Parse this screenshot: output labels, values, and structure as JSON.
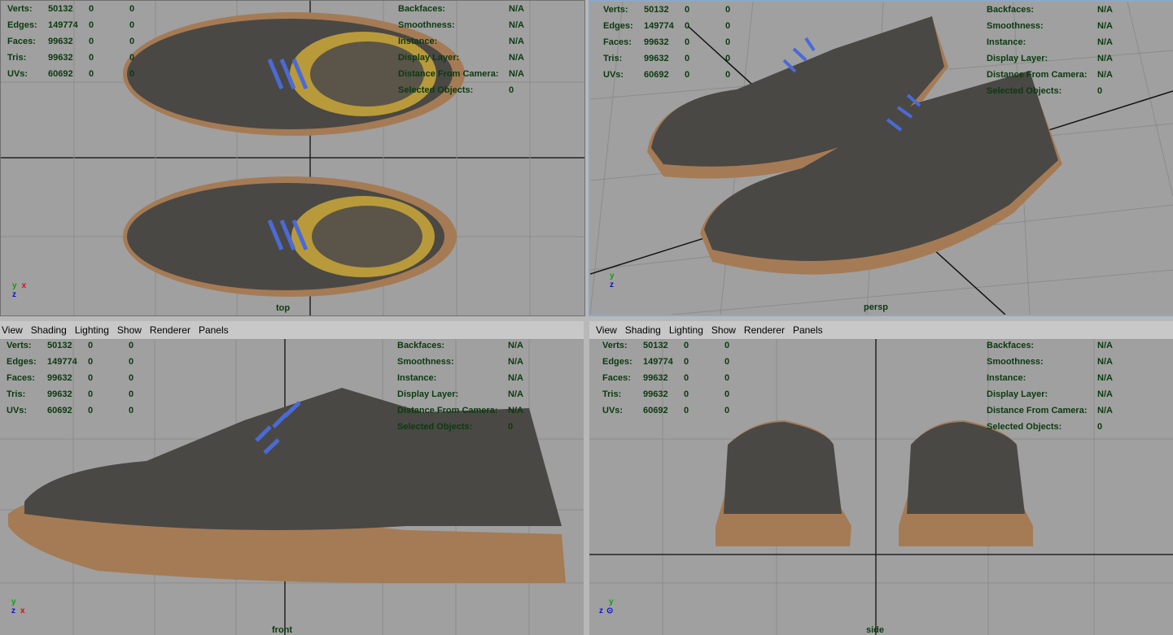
{
  "menu": [
    "View",
    "Shading",
    "Lighting",
    "Show",
    "Renderer",
    "Panels"
  ],
  "stats": {
    "left": [
      {
        "label": "Verts:",
        "value": "50132",
        "a": "0",
        "b": "0"
      },
      {
        "label": "Edges:",
        "value": "149774",
        "a": "0",
        "b": "0"
      },
      {
        "label": "Faces:",
        "value": "99632",
        "a": "0",
        "b": "0"
      },
      {
        "label": "Tris:",
        "value": "99632",
        "a": "0",
        "b": "0"
      },
      {
        "label": "UVs:",
        "value": "60692",
        "a": "0",
        "b": "0"
      }
    ],
    "right": [
      {
        "label": "Backfaces:",
        "value": "N/A"
      },
      {
        "label": "Smoothness:",
        "value": "N/A"
      },
      {
        "label": "Instance:",
        "value": "N/A"
      },
      {
        "label": "Display Layer:",
        "value": "N/A"
      },
      {
        "label": "Distance From Camera:",
        "value": "N/A"
      },
      {
        "label": "Selected Objects:",
        "value": "0"
      }
    ]
  },
  "views": {
    "top": "top",
    "persp": "persp",
    "front": "front",
    "side": "side"
  },
  "axes": {
    "x": "x",
    "y": "y",
    "z": "z"
  },
  "colors": {
    "stat_text": "#0b3a10",
    "grid": "#8a8a8a",
    "axis_x": "#d01010",
    "axis_y": "#10a010",
    "axis_z": "#1010d0",
    "shoe_leather": "#4a4844",
    "sole": "#a57b55",
    "lace": "#4a6ad8"
  }
}
